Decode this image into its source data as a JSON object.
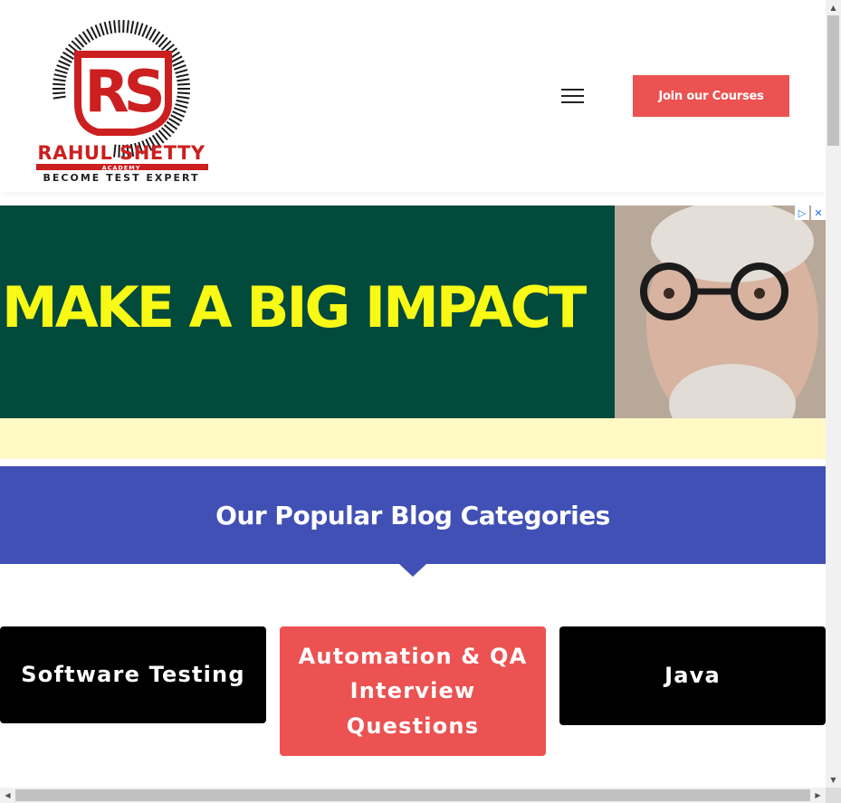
{
  "header": {
    "logo": {
      "monogram": "RS",
      "name": "RAHUL SHETTY",
      "sub": "ACADEMY",
      "tagline": "BECOME TEST EXPERT"
    },
    "menu_icon": "hamburger-icon",
    "cta_label": "Join our Courses"
  },
  "ad": {
    "headline": "MAKE A BIG IMPACT",
    "adchoices_icon": "adchoices-icon",
    "close_icon": "close-icon"
  },
  "section": {
    "title": "Our Popular Blog Categories"
  },
  "categories": [
    {
      "label": "Software Testing"
    },
    {
      "label": "Automation & QA Interview Questions"
    },
    {
      "label": "Java"
    }
  ],
  "colors": {
    "accent_red": "#ec5252",
    "banner_blue": "#4150b5",
    "ad_green": "#024a3c",
    "ad_yellow": "#f9f916",
    "ad_strip": "#fef9c5",
    "logo_red": "#cc1f1f"
  }
}
